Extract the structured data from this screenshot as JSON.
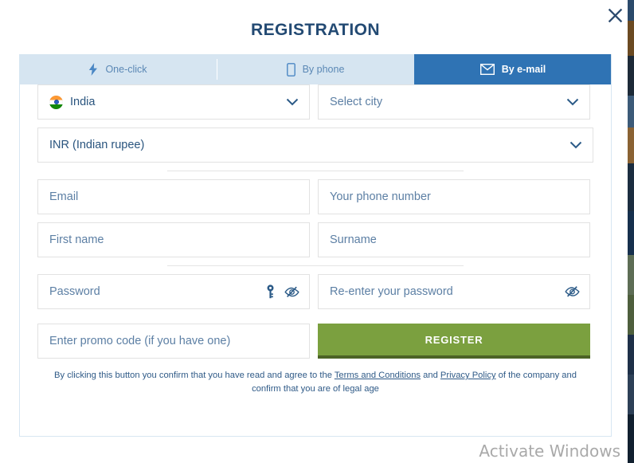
{
  "modal": {
    "title": "REGISTRATION",
    "close_label": "close-icon"
  },
  "tabs": [
    {
      "label": "One-click",
      "icon": "lightning-bolt-icon",
      "active": false
    },
    {
      "label": "By phone",
      "icon": "mobile-phone-icon",
      "active": false
    },
    {
      "label": "By e-mail",
      "icon": "envelope-icon",
      "active": true
    }
  ],
  "form": {
    "country": {
      "value": "India",
      "flag": "india-flag-icon"
    },
    "city": {
      "placeholder": "Select city"
    },
    "currency": {
      "value": "INR (Indian rupee)"
    },
    "email": {
      "placeholder": "Email",
      "value": ""
    },
    "phone": {
      "placeholder": "Your phone number",
      "value": ""
    },
    "first_name": {
      "placeholder": "First name",
      "value": ""
    },
    "surname": {
      "placeholder": "Surname",
      "value": ""
    },
    "password": {
      "placeholder": "Password",
      "value": "",
      "key_icon": "key-icon",
      "toggle_icon": "eye-slash-icon"
    },
    "password_confirm": {
      "placeholder": "Re-enter your password",
      "value": "",
      "toggle_icon": "eye-slash-icon"
    },
    "promo": {
      "placeholder": "Enter promo code (if you have one)",
      "value": ""
    },
    "register_label": "REGISTER"
  },
  "legal": {
    "text_before": "By clicking this button you confirm that you have read and agree to the ",
    "terms_link": "Terms and Conditions",
    "text_middle": " and ",
    "privacy_link": "Privacy Policy",
    "text_after": " of the company and confirm that you are of legal age"
  },
  "watermark": {
    "line1": "Activate Windows"
  },
  "colors": {
    "accent_blue": "#2f73b4",
    "tab_inactive_bg": "#d6e5f1",
    "title_navy": "#234a73",
    "register_green": "#7ba03f",
    "register_green_dark": "#4c6326",
    "field_border": "#e2e2e2",
    "modal_border": "#d7e6f2"
  }
}
